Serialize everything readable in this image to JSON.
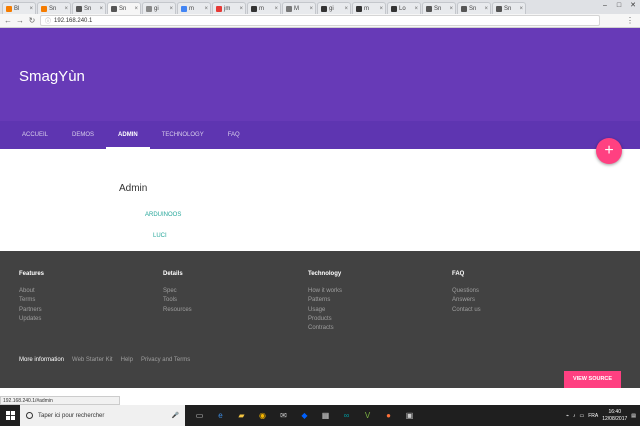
{
  "browser": {
    "tabs": [
      {
        "label": "Bl",
        "color": "#f57c00"
      },
      {
        "label": "Sn",
        "color": "#f57c00"
      },
      {
        "label": "Sn",
        "color": "#555555"
      },
      {
        "label": "Sn",
        "color": "#555555",
        "active": true
      },
      {
        "label": "gi",
        "color": "#888888"
      },
      {
        "label": "m",
        "color": "#4285f4"
      },
      {
        "label": "jm",
        "color": "#e53935"
      },
      {
        "label": "m",
        "color": "#333333"
      },
      {
        "label": "M",
        "color": "#777777"
      },
      {
        "label": "gi",
        "color": "#333333"
      },
      {
        "label": "m",
        "color": "#333333"
      },
      {
        "label": "Lo",
        "color": "#333333"
      },
      {
        "label": "Sn",
        "color": "#555555"
      },
      {
        "label": "Sn",
        "color": "#555555"
      },
      {
        "label": "Sn",
        "color": "#555555"
      }
    ],
    "url": "192.168.240.1",
    "status_url": "192.168.240.1/#admin"
  },
  "header": {
    "title": "SmagYùn"
  },
  "nav": {
    "items": [
      "ACCUEIL",
      "DEMOS",
      "ADMIN",
      "TECHNOLOGY",
      "FAQ"
    ],
    "active": "ADMIN"
  },
  "fab": {
    "label": "+"
  },
  "main": {
    "title": "Admin",
    "link1": "ARDUINOOS",
    "link2": "LUCI"
  },
  "footer": {
    "columns": [
      {
        "heading": "Features",
        "links": [
          "About",
          "Terms",
          "Partners",
          "Updates"
        ]
      },
      {
        "heading": "Details",
        "links": [
          "Spec",
          "Tools",
          "Resources"
        ]
      },
      {
        "heading": "Technology",
        "links": [
          "How it works",
          "Patterns",
          "Usage",
          "Products",
          "Contracts"
        ]
      },
      {
        "heading": "FAQ",
        "links": [
          "Questions",
          "Answers",
          "Contact us"
        ]
      }
    ],
    "bottom": {
      "more_info": "More information",
      "links": [
        "Web Starter Kit",
        "Help",
        "Privacy and Terms"
      ]
    },
    "view_source": "VIEW SOURCE"
  },
  "taskbar": {
    "search_placeholder": "Taper ici pour rechercher",
    "lang": "FRA",
    "time": "16:40",
    "date": "12/08/2017"
  },
  "colors": {
    "header": "#673ab7",
    "nav": "#5e35b1",
    "accent": "#ff4081",
    "link": "#26a69a",
    "footer": "#424242"
  }
}
